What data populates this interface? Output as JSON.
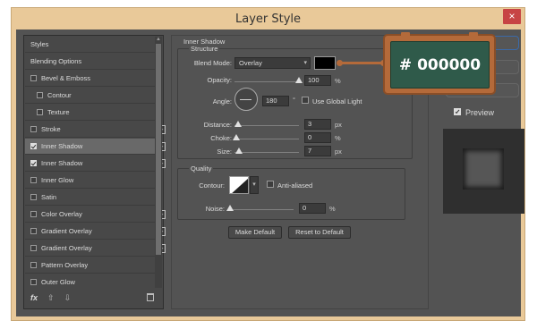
{
  "window": {
    "title": "Layer Style",
    "close_glyph": "×"
  },
  "left_panel": {
    "items": [
      {
        "label": "Styles",
        "checkbox": null,
        "plus": false,
        "selected": false
      },
      {
        "label": "Blending Options",
        "checkbox": null,
        "plus": false,
        "selected": false
      },
      {
        "label": "Bevel & Emboss",
        "checkbox": false,
        "plus": false,
        "selected": false
      },
      {
        "label": "Contour",
        "checkbox": false,
        "plus": false,
        "selected": false,
        "indent": true
      },
      {
        "label": "Texture",
        "checkbox": false,
        "plus": false,
        "selected": false,
        "indent": true
      },
      {
        "label": "Stroke",
        "checkbox": false,
        "plus": true,
        "selected": false
      },
      {
        "label": "Inner Shadow",
        "checkbox": true,
        "plus": true,
        "selected": true
      },
      {
        "label": "Inner Shadow",
        "checkbox": true,
        "plus": true,
        "selected": false
      },
      {
        "label": "Inner Glow",
        "checkbox": false,
        "plus": false,
        "selected": false
      },
      {
        "label": "Satin",
        "checkbox": false,
        "plus": false,
        "selected": false
      },
      {
        "label": "Color Overlay",
        "checkbox": false,
        "plus": true,
        "selected": false
      },
      {
        "label": "Gradient Overlay",
        "checkbox": false,
        "plus": true,
        "selected": false
      },
      {
        "label": "Gradient Overlay",
        "checkbox": false,
        "plus": true,
        "selected": false
      },
      {
        "label": "Pattern Overlay",
        "checkbox": false,
        "plus": false,
        "selected": false
      },
      {
        "label": "Outer Glow",
        "checkbox": false,
        "plus": false,
        "selected": false
      }
    ],
    "bottom": {
      "fx": "fx",
      "up": "⇧",
      "down": "⇩",
      "trash_icon": "trash-icon"
    }
  },
  "inner_shadow": {
    "section_title": "Inner Shadow",
    "structure_title": "Structure",
    "blend_mode_label": "Blend Mode:",
    "blend_mode_value": "Overlay",
    "color": "#000000",
    "opacity_label": "Opacity:",
    "opacity_value": "100",
    "opacity_unit": "%",
    "opacity_level": 1.0,
    "angle_label": "Angle:",
    "angle_value": "180",
    "angle_unit": "°",
    "global_light_label": "Use Global Light",
    "distance_label": "Distance:",
    "distance_value": "3",
    "distance_unit": "px",
    "choke_label": "Choke:",
    "choke_value": "0",
    "choke_unit": "%",
    "size_label": "Size:",
    "size_value": "7",
    "size_unit": "px"
  },
  "quality": {
    "title": "Quality",
    "contour_label": "Contour:",
    "anti_aliased_label": "Anti-aliased",
    "noise_label": "Noise:",
    "noise_value": "0",
    "noise_unit": "%"
  },
  "buttons": {
    "make_default": "Make Default",
    "reset_default": "Reset to Default"
  },
  "preview": {
    "label": "Preview",
    "checked": true
  },
  "callout": {
    "text": "# 000000"
  }
}
